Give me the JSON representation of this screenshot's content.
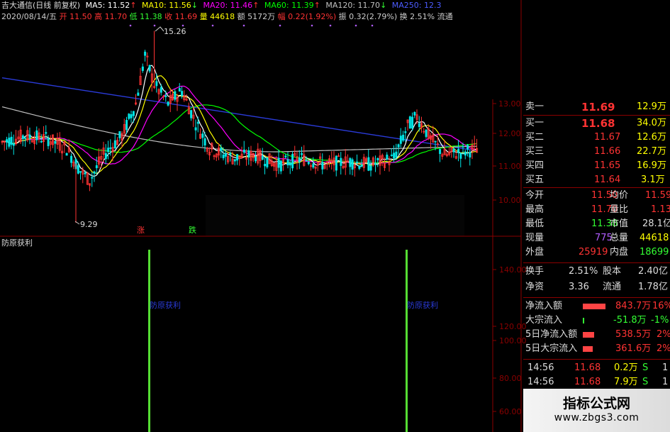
{
  "header": {
    "title": "吉大通信(日线 前复权)",
    "ma5": "MA5: 11.52",
    "ma10": "MA10: 11.56",
    "ma20": "MA20: 11.46",
    "ma60": "MA60: 11.39",
    "ma120": "MA120: 11.70",
    "ma250": "MA250: 12.3",
    "date": "2020/08/14/五",
    "open": "开 11.50",
    "high": "高 11.70",
    "low": "低 11.38",
    "close": "收 11.69",
    "volume": "量 44618",
    "amount": "额 5172万",
    "change": "幅 0.22(1.92%)",
    "amplitude": "振 0.32(2.79%)",
    "turnover": "换 2.51%",
    "float": "流通"
  },
  "colors": {
    "up": "#ff3333",
    "down": "#00e5e5",
    "ma5": "#ffffff",
    "ma10": "#ffff00",
    "ma20": "#ff00ff",
    "ma60": "#00ff00",
    "ma120": "#c0c0c0",
    "ma250": "#2a3bd8",
    "signal": "#55dd33"
  },
  "kchart": {
    "price_axis": [
      "13.00",
      "12.00",
      "11.00",
      "10.00"
    ],
    "annotations": {
      "peak": "15.26",
      "trough": "9.29"
    },
    "markers": {
      "rise": "涨",
      "fall": "跌"
    }
  },
  "indicator": {
    "name": "防原获利",
    "axis": [
      "140.00",
      "120.00",
      "100.00",
      "80.00",
      "60.00"
    ],
    "signal_label": "防原获利"
  },
  "quote": {
    "asks": [
      {
        "label": "卖一",
        "price": "11.69",
        "vol": "12.9万"
      }
    ],
    "bids": [
      {
        "label": "买一",
        "price": "11.68",
        "vol": "34.0万"
      },
      {
        "label": "买二",
        "price": "11.67",
        "vol": "12.6万"
      },
      {
        "label": "买三",
        "price": "11.66",
        "vol": "22.7万"
      },
      {
        "label": "买四",
        "price": "11.65",
        "vol": "16.9万"
      },
      {
        "label": "买五",
        "price": "11.64",
        "vol": "3.1万"
      }
    ],
    "stats": [
      {
        "l1": "今开",
        "v1": "11.50",
        "l2": "均价",
        "v2": "11.59"
      },
      {
        "l1": "最高",
        "v1": "11.70",
        "l2": "量比",
        "v2": "1.13"
      },
      {
        "l1": "最低",
        "v1": "11.38",
        "l2": "市值",
        "v2": "28.1亿"
      },
      {
        "l1": "现量",
        "v1": "775",
        "l2": "总量",
        "v2": "44618"
      },
      {
        "l1": "外盘",
        "v1": "25919",
        "l2": "内盘",
        "v2": "18699"
      }
    ],
    "stats2": [
      {
        "l1": "换手",
        "v1": "2.51%",
        "l2": "股本",
        "v2": "2.40亿"
      },
      {
        "l1": "净资",
        "v1": "3.36",
        "l2": "流通",
        "v2": "1.78亿"
      }
    ],
    "flows": [
      {
        "label": "净流入额",
        "value": "843.7万",
        "pct": "16%",
        "bar": 0.16
      },
      {
        "label": "大宗流入",
        "value": "-51.8万",
        "pct": "-1%",
        "bar": 0.01
      },
      {
        "label": "5日净流入额",
        "value": "538.5万",
        "pct": "2%",
        "bar": 0.02
      },
      {
        "label": "5日大宗流入",
        "value": "361.6万",
        "pct": "2%",
        "bar": 0.02
      }
    ],
    "ticks": [
      {
        "time": "14:56",
        "price": "11.68",
        "vol": "0.2万",
        "side": "S",
        "n": "1"
      },
      {
        "time": "14:56",
        "price": "11.68",
        "vol": "7.9万",
        "side": "S",
        "n": "1"
      }
    ]
  },
  "watermark": {
    "title": "指标公式网",
    "url": "www.zbgs3.com"
  }
}
